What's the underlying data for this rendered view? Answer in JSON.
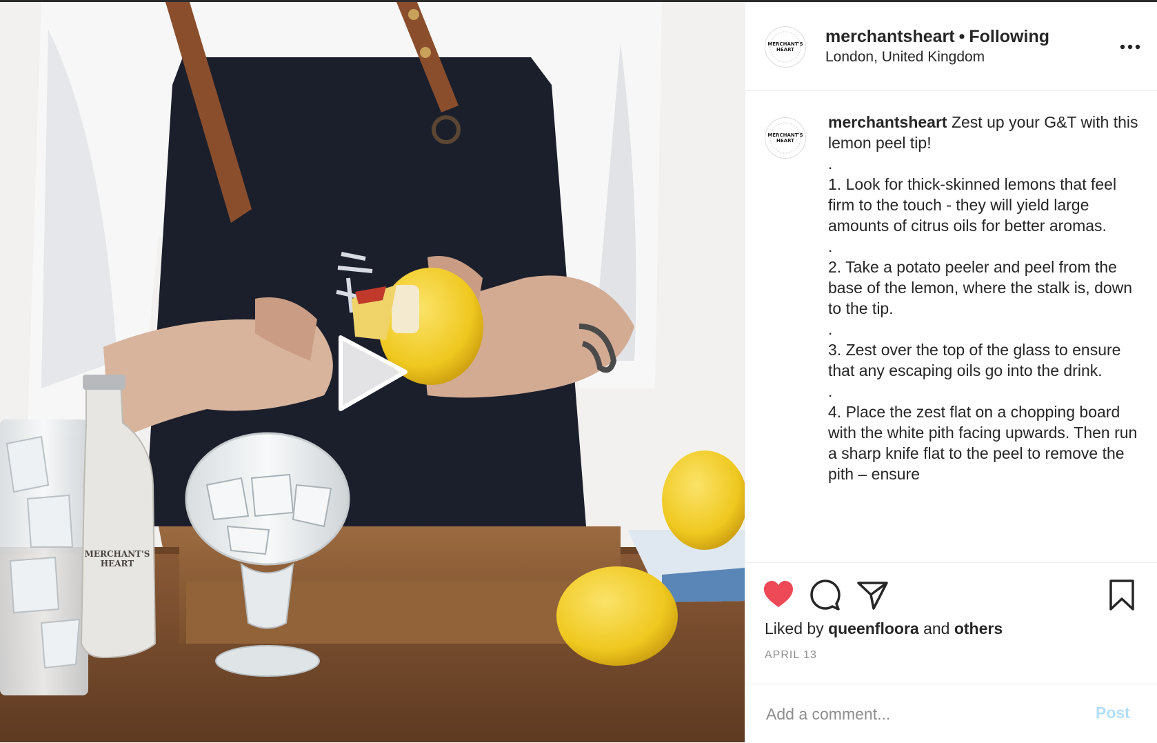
{
  "post": {
    "username": "merchantsheart",
    "separator": "•",
    "follow_status": "Following",
    "location": "London, United Kingdom",
    "more_icon": "more-options-icon",
    "avatar_logo_line1": "MERCHANT'S",
    "avatar_logo_line2": "HEART",
    "media_bottle_label_line1": "MERCHANT'S",
    "media_bottle_label_line2": "HEART"
  },
  "caption": {
    "username": "merchantsheart",
    "lines": [
      "Zest up your G&T with this lemon peel tip!",
      ".",
      "1.  Look for thick-skinned lemons that feel firm to the touch - they will yield large amounts of citrus oils for better aromas.",
      ".",
      "2. Take a potato peeler and peel from the base of the lemon, where the stalk is, down to the tip.",
      ".",
      "3. Zest over the top of the glass to ensure that any escaping oils go into the drink.",
      ".",
      "4. Place the zest flat on a chopping board with the white pith facing upwards. Then run a sharp knife flat to the peel to remove the pith – ensure"
    ]
  },
  "actions": {
    "liked": true,
    "like_color": "#ed4956",
    "icons": [
      "heart-icon",
      "comment-icon",
      "share-icon",
      "bookmark-icon"
    ]
  },
  "likes": {
    "prefix": "Liked by",
    "user": "queenfloora",
    "joiner": "and",
    "others": "others"
  },
  "date": "APRIL 13",
  "comment": {
    "placeholder": "Add a comment...",
    "post_label": "Post"
  }
}
